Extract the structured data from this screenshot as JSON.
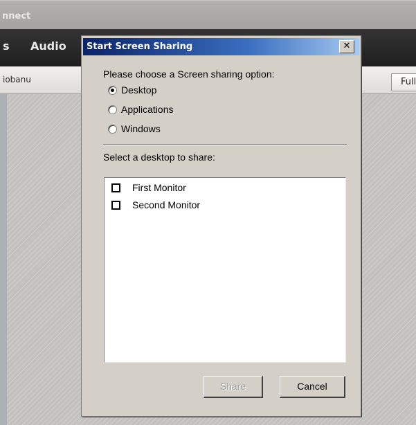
{
  "app": {
    "title": "nnect",
    "menu": [
      "s",
      "Audio"
    ],
    "subbar_label": "iobanu",
    "full_button": "Full"
  },
  "dialog": {
    "title": "Start Screen Sharing",
    "close_label": "✕",
    "prompt": "Please choose a Screen sharing option:",
    "options": [
      {
        "label": "Desktop",
        "selected": true
      },
      {
        "label": "Applications",
        "selected": false
      },
      {
        "label": "Windows",
        "selected": false
      }
    ],
    "select_label": "Select a desktop to share:",
    "desktops": [
      {
        "label": "First Monitor",
        "checked": false
      },
      {
        "label": "Second Monitor",
        "checked": false
      }
    ],
    "share_button": "Share",
    "share_enabled": false,
    "cancel_button": "Cancel"
  },
  "colors": {
    "title_gradient_start": "#0a246a",
    "title_gradient_end": "#a6caf0",
    "dialog_face": "#d4d0c8",
    "menubar": "#2a2a2a"
  }
}
